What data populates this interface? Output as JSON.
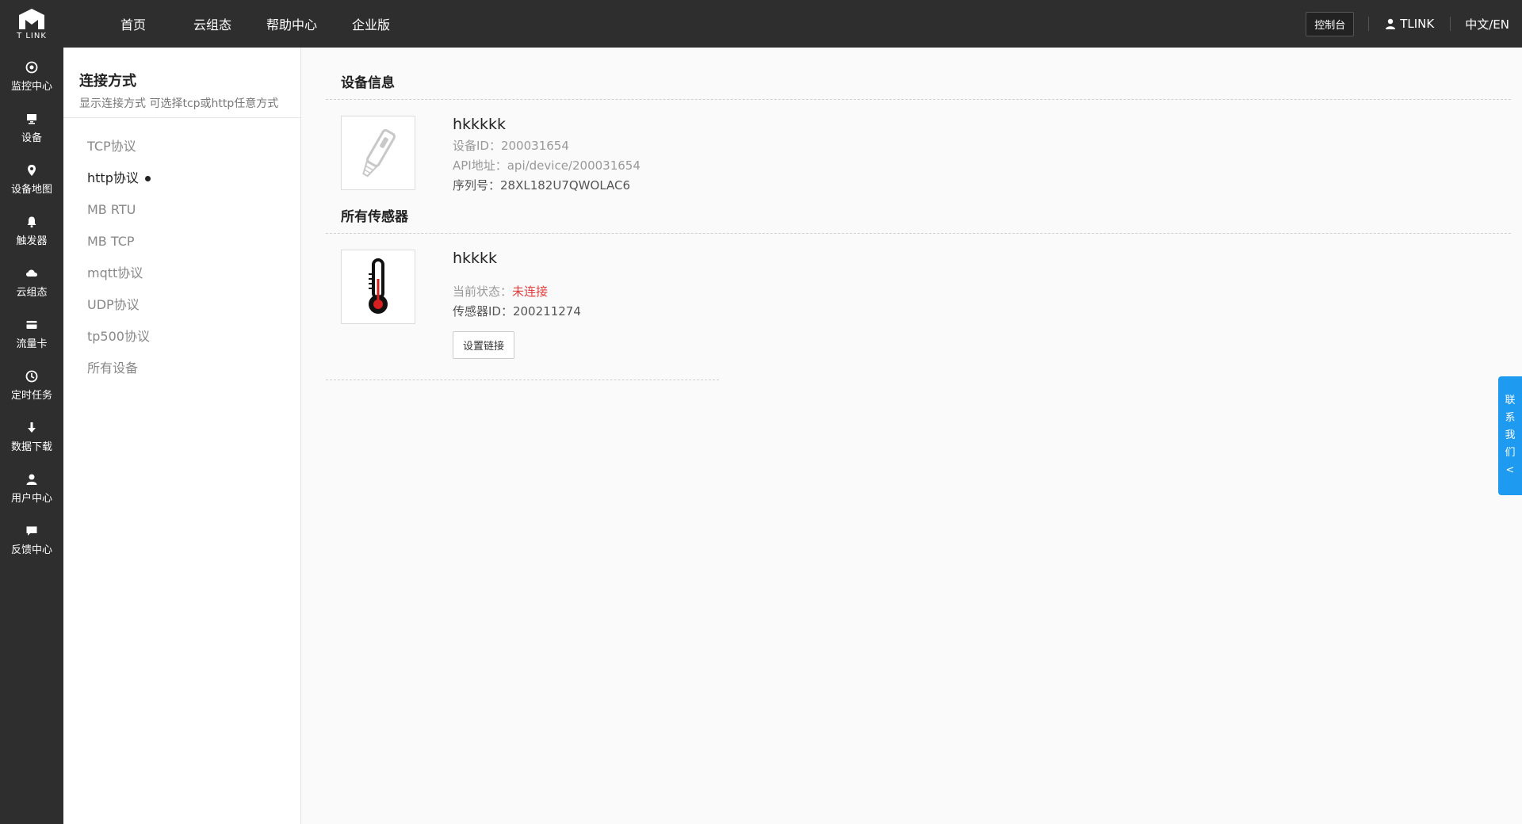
{
  "brand": {
    "logo_text": "T LINK"
  },
  "topnav": {
    "items": [
      "首页",
      "云组态",
      "帮助中心",
      "企业版"
    ]
  },
  "topbar_right": {
    "console_label": "控制台",
    "user_label": "TLINK",
    "lang_label": "中文/EN"
  },
  "iconbar": {
    "items": [
      {
        "label": "监控中心",
        "icon": "target-icon"
      },
      {
        "label": "设备",
        "icon": "monitor-icon"
      },
      {
        "label": "设备地图",
        "icon": "map-pin-icon"
      },
      {
        "label": "触发器",
        "icon": "bell-icon"
      },
      {
        "label": "云组态",
        "icon": "cloud-icon"
      },
      {
        "label": "流量卡",
        "icon": "card-icon"
      },
      {
        "label": "定时任务",
        "icon": "clock-icon"
      },
      {
        "label": "数据下载",
        "icon": "download-icon"
      },
      {
        "label": "用户中心",
        "icon": "user-icon"
      },
      {
        "label": "反馈中心",
        "icon": "chat-icon"
      }
    ]
  },
  "subnav": {
    "title": "连接方式",
    "desc": "显示连接方式 可选择tcp或http任意方式",
    "items": [
      "TCP协议",
      "http协议",
      "MB RTU",
      "MB TCP",
      "mqtt协议",
      "UDP协议",
      "tp500协议",
      "所有设备"
    ],
    "active_index": 1
  },
  "device_section": {
    "title": "设备信息",
    "name": "hkkkkk",
    "device_id": "设备ID：200031654",
    "api": "API地址：api/device/200031654",
    "serial": "序列号：28XL182U7QWOLAC6",
    "icon": "cutter-icon"
  },
  "sensor_section": {
    "title": "所有传感器",
    "name": "hkkkk",
    "status_label": "当前状态：",
    "status_value": "未连接",
    "sensor_id": "传感器ID：200211274",
    "button_label": "设置链接",
    "icon": "thermometer-icon"
  },
  "contact_tab": {
    "chars": [
      "联",
      "系",
      "我",
      "们",
      "<"
    ]
  },
  "colors": {
    "topbar": "#2e2e2e",
    "accent_blue": "#1e9bf0",
    "status_red": "#e23c3c"
  }
}
